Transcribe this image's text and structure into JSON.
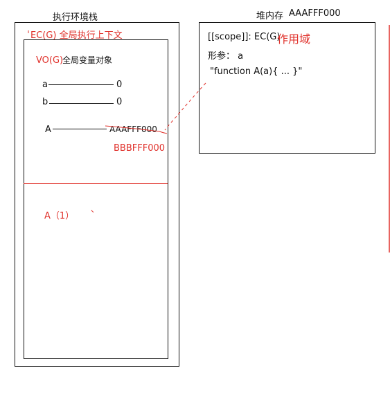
{
  "stack": {
    "title": "执行环境栈",
    "ec_label": "EC(G) 全局执行上下文",
    "vo_label": "VO(G)",
    "vo_desc": "全局变量对象",
    "variables": [
      {
        "name": "a",
        "value": "0"
      },
      {
        "name": "b",
        "value": "0"
      },
      {
        "name": "A",
        "value": "AAAFFF000"
      }
    ],
    "new_address": "BBBFFF000",
    "call_label": "A（1）"
  },
  "heap": {
    "title": "堆内存",
    "address": "AAAFFF000",
    "scope_line": "[[scope]]: EC(G)",
    "scope_note": "作用域",
    "params_line": "形参： a",
    "code_line": "\"function A(a){ ... }\""
  },
  "colors": {
    "annotation": "#e0312b",
    "ink": "#111111"
  }
}
